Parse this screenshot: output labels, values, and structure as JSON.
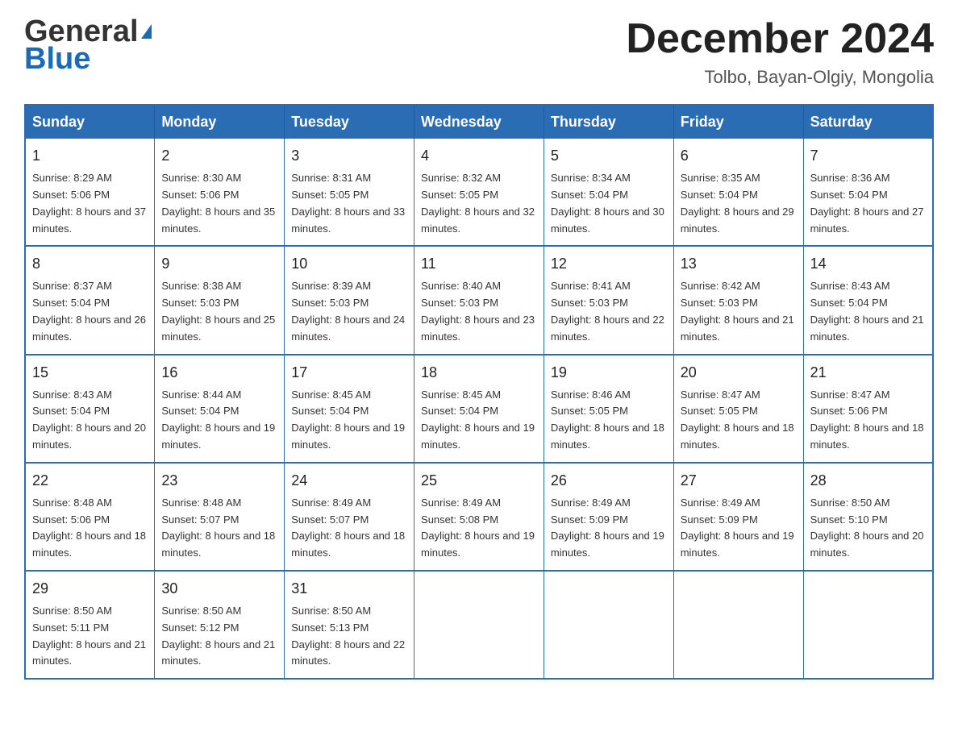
{
  "header": {
    "logo": {
      "general": "General",
      "blue": "Blue",
      "aria": "GeneralBlue Logo"
    },
    "title": "December 2024",
    "subtitle": "Tolbo, Bayan-Olgiy, Mongolia"
  },
  "calendar": {
    "days": [
      "Sunday",
      "Monday",
      "Tuesday",
      "Wednesday",
      "Thursday",
      "Friday",
      "Saturday"
    ],
    "weeks": [
      [
        {
          "day": "1",
          "sunrise": "8:29 AM",
          "sunset": "5:06 PM",
          "daylight": "8 hours and 37 minutes."
        },
        {
          "day": "2",
          "sunrise": "8:30 AM",
          "sunset": "5:06 PM",
          "daylight": "8 hours and 35 minutes."
        },
        {
          "day": "3",
          "sunrise": "8:31 AM",
          "sunset": "5:05 PM",
          "daylight": "8 hours and 33 minutes."
        },
        {
          "day": "4",
          "sunrise": "8:32 AM",
          "sunset": "5:05 PM",
          "daylight": "8 hours and 32 minutes."
        },
        {
          "day": "5",
          "sunrise": "8:34 AM",
          "sunset": "5:04 PM",
          "daylight": "8 hours and 30 minutes."
        },
        {
          "day": "6",
          "sunrise": "8:35 AM",
          "sunset": "5:04 PM",
          "daylight": "8 hours and 29 minutes."
        },
        {
          "day": "7",
          "sunrise": "8:36 AM",
          "sunset": "5:04 PM",
          "daylight": "8 hours and 27 minutes."
        }
      ],
      [
        {
          "day": "8",
          "sunrise": "8:37 AM",
          "sunset": "5:04 PM",
          "daylight": "8 hours and 26 minutes."
        },
        {
          "day": "9",
          "sunrise": "8:38 AM",
          "sunset": "5:03 PM",
          "daylight": "8 hours and 25 minutes."
        },
        {
          "day": "10",
          "sunrise": "8:39 AM",
          "sunset": "5:03 PM",
          "daylight": "8 hours and 24 minutes."
        },
        {
          "day": "11",
          "sunrise": "8:40 AM",
          "sunset": "5:03 PM",
          "daylight": "8 hours and 23 minutes."
        },
        {
          "day": "12",
          "sunrise": "8:41 AM",
          "sunset": "5:03 PM",
          "daylight": "8 hours and 22 minutes."
        },
        {
          "day": "13",
          "sunrise": "8:42 AM",
          "sunset": "5:03 PM",
          "daylight": "8 hours and 21 minutes."
        },
        {
          "day": "14",
          "sunrise": "8:43 AM",
          "sunset": "5:04 PM",
          "daylight": "8 hours and 21 minutes."
        }
      ],
      [
        {
          "day": "15",
          "sunrise": "8:43 AM",
          "sunset": "5:04 PM",
          "daylight": "8 hours and 20 minutes."
        },
        {
          "day": "16",
          "sunrise": "8:44 AM",
          "sunset": "5:04 PM",
          "daylight": "8 hours and 19 minutes."
        },
        {
          "day": "17",
          "sunrise": "8:45 AM",
          "sunset": "5:04 PM",
          "daylight": "8 hours and 19 minutes."
        },
        {
          "day": "18",
          "sunrise": "8:45 AM",
          "sunset": "5:04 PM",
          "daylight": "8 hours and 19 minutes."
        },
        {
          "day": "19",
          "sunrise": "8:46 AM",
          "sunset": "5:05 PM",
          "daylight": "8 hours and 18 minutes."
        },
        {
          "day": "20",
          "sunrise": "8:47 AM",
          "sunset": "5:05 PM",
          "daylight": "8 hours and 18 minutes."
        },
        {
          "day": "21",
          "sunrise": "8:47 AM",
          "sunset": "5:06 PM",
          "daylight": "8 hours and 18 minutes."
        }
      ],
      [
        {
          "day": "22",
          "sunrise": "8:48 AM",
          "sunset": "5:06 PM",
          "daylight": "8 hours and 18 minutes."
        },
        {
          "day": "23",
          "sunrise": "8:48 AM",
          "sunset": "5:07 PM",
          "daylight": "8 hours and 18 minutes."
        },
        {
          "day": "24",
          "sunrise": "8:49 AM",
          "sunset": "5:07 PM",
          "daylight": "8 hours and 18 minutes."
        },
        {
          "day": "25",
          "sunrise": "8:49 AM",
          "sunset": "5:08 PM",
          "daylight": "8 hours and 19 minutes."
        },
        {
          "day": "26",
          "sunrise": "8:49 AM",
          "sunset": "5:09 PM",
          "daylight": "8 hours and 19 minutes."
        },
        {
          "day": "27",
          "sunrise": "8:49 AM",
          "sunset": "5:09 PM",
          "daylight": "8 hours and 19 minutes."
        },
        {
          "day": "28",
          "sunrise": "8:50 AM",
          "sunset": "5:10 PM",
          "daylight": "8 hours and 20 minutes."
        }
      ],
      [
        {
          "day": "29",
          "sunrise": "8:50 AM",
          "sunset": "5:11 PM",
          "daylight": "8 hours and 21 minutes."
        },
        {
          "day": "30",
          "sunrise": "8:50 AM",
          "sunset": "5:12 PM",
          "daylight": "8 hours and 21 minutes."
        },
        {
          "day": "31",
          "sunrise": "8:50 AM",
          "sunset": "5:13 PM",
          "daylight": "8 hours and 22 minutes."
        },
        null,
        null,
        null,
        null
      ]
    ]
  }
}
